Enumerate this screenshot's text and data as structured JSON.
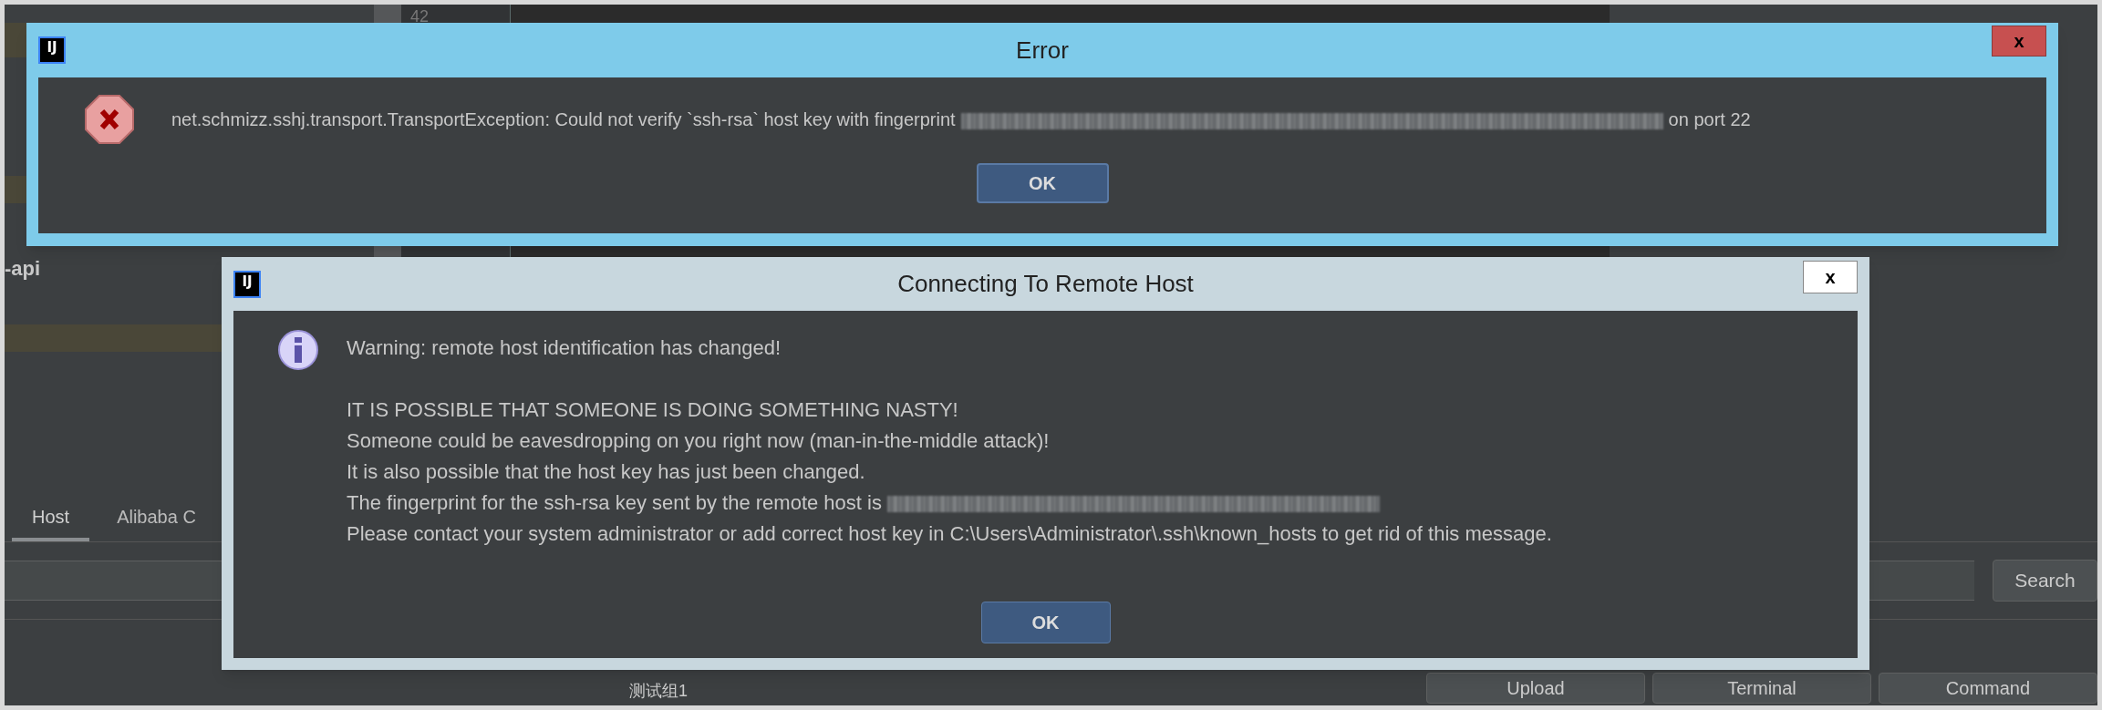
{
  "background": {
    "gutter_number": "42",
    "project_label": "-api",
    "tabs": [
      {
        "label": "Host",
        "selected": true
      },
      {
        "label": "Alibaba C",
        "selected": false
      }
    ],
    "search_button": "Search",
    "group_label": "测试组1",
    "action_buttons": [
      "Upload",
      "Terminal",
      "Command"
    ]
  },
  "error_dialog": {
    "app_icon": "IJ",
    "title": "Error",
    "close": "x",
    "message_before": "net.schmizz.sshj.transport.TransportException: Could not verify `ssh-rsa` host key with fingerprint",
    "message_after": "on port 22",
    "ok_button": "OK"
  },
  "connect_dialog": {
    "app_icon": "IJ",
    "title": "Connecting To Remote Host",
    "close": "x",
    "warning": "Warning: remote host identification has changed!",
    "lines": [
      "IT IS POSSIBLE THAT SOMEONE IS DOING SOMETHING NASTY!",
      "Someone could be eavesdropping on you right now (man-in-the-middle attack)!",
      "It is also possible that the host key has just been changed."
    ],
    "fingerprint_line": "The fingerprint for the ssh-rsa key sent by the remote host is",
    "last_line": "Please contact your system administrator or add correct host key in C:\\Users\\Administrator\\.ssh\\known_hosts to get rid of this message.",
    "ok_button": "OK"
  }
}
